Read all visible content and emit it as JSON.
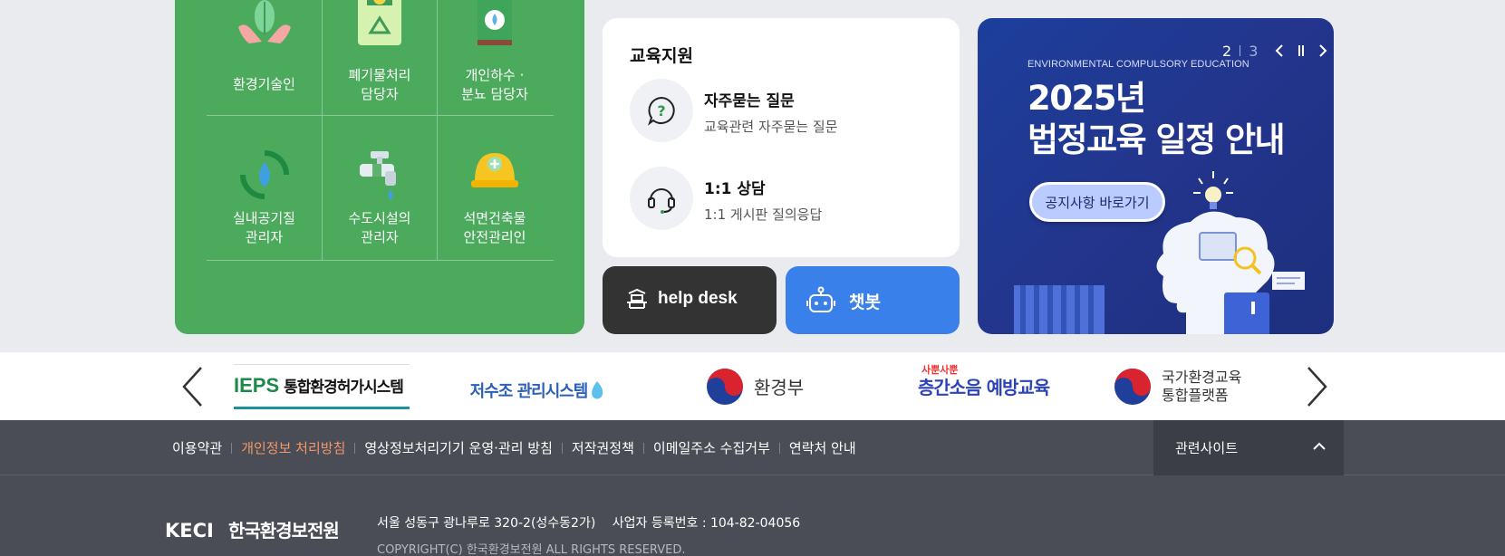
{
  "targets": [
    {
      "label": "환경기술인",
      "icon": "plant-hands-icon"
    },
    {
      "label": "폐기물처리\n담당자",
      "icon": "recycle-bin-icon"
    },
    {
      "label": "개인하수 ·\n분뇨 담당자",
      "icon": "water-tank-icon"
    },
    {
      "label": "실내공기질\n관리자",
      "icon": "cycle-drop-icon"
    },
    {
      "label": "수도시설의\n관리자",
      "icon": "faucet-icon"
    },
    {
      "label": "석면건축물\n안전관리인",
      "icon": "helmet-icon"
    }
  ],
  "education": {
    "title": "교육지원",
    "items": [
      {
        "title": "자주묻는 질문",
        "desc": "교육관련 자주묻는 질문",
        "icon": "question-bubble-icon"
      },
      {
        "title": "1:1 상담",
        "desc": "1:1 게시판 질의응답",
        "icon": "headset-icon"
      }
    ]
  },
  "buttons": {
    "help_desk": "help desk",
    "chatbot": "챗봇",
    "help_color": "#333333",
    "chat_color": "#3a80ea"
  },
  "banner": {
    "current": "2",
    "total": "3",
    "subtitle_en": "ENVIRONMENTAL COMPULSORY EDUCATION",
    "title": "2025년\n법정교육 일정 안내",
    "cta": "공지사항 바로가기"
  },
  "partners": {
    "ieps_brand": "IEPS",
    "ieps_name": "통합환경허가시스템",
    "reservoir": "저수조 관리시스템",
    "ministry": "환경부",
    "noise_small": "사뿐사뿐",
    "noise_main": "층간소음 예방교육",
    "platform": "국가환경교육\n통합플랫폼"
  },
  "footer": {
    "links": [
      "이용약관",
      "개인정보 처리방침",
      "영상정보처리기기 운영·관리 방침",
      "저작권정책",
      "이메일주소 수집거부",
      "연락처 안내"
    ],
    "highlight_color": "#f0976b",
    "related": "관련사이트",
    "logo_en": "KECI",
    "logo_kor": "한국환경보전원",
    "address": "서울 성동구 광나루로 320-2(성수동2가)",
    "business_no": "사업자 등록번호 : 104-82-04056",
    "copyright": "COPYRIGHT(C) 한국환경보전원 ALL RIGHTS RESERVED."
  }
}
